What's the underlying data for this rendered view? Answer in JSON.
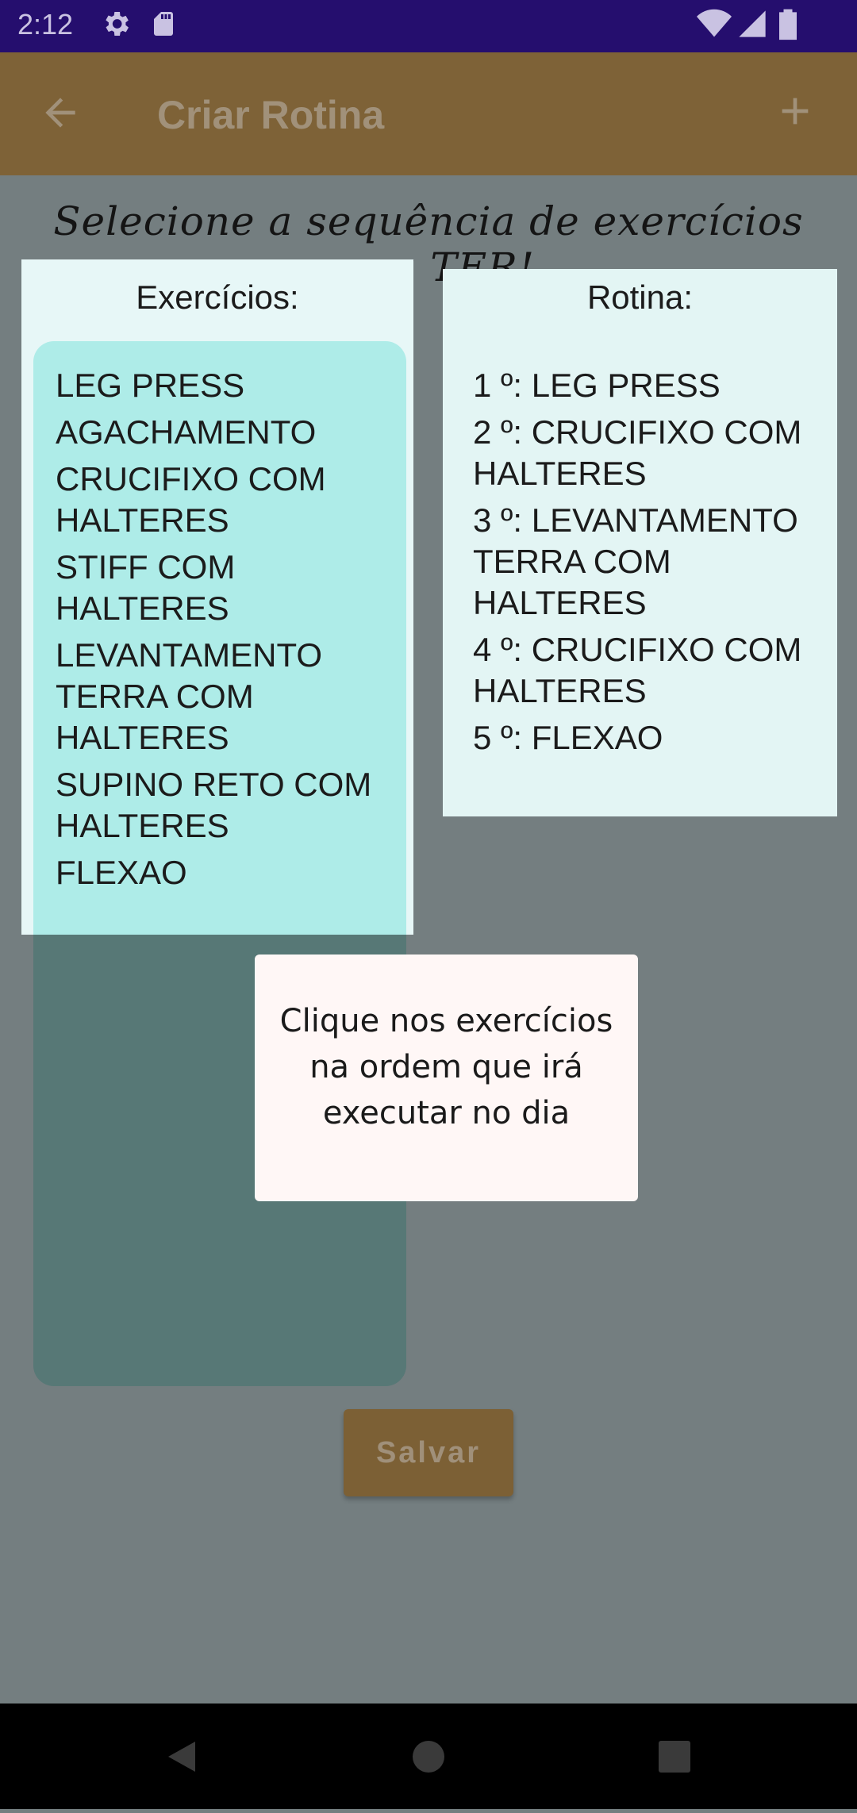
{
  "status_bar": {
    "time": "2:12",
    "icons": [
      "gear-icon",
      "sd-card-icon",
      "wifi-icon",
      "cell-signal-icon",
      "battery-icon"
    ]
  },
  "app_bar": {
    "title": "Criar Rotina",
    "back_icon": "arrow-left-icon",
    "add_icon": "plus-icon"
  },
  "main": {
    "subtitle": "Selecione a sequência de exercícios para TER!",
    "exercises_title": "Exercícios:",
    "exercises": [
      "LEG PRESS",
      "AGACHAMENTO",
      "CRUCIFIXO COM HALTERES",
      "STIFF COM HALTERES",
      "LEVANTAMENTO TERRA COM HALTERES",
      "SUPINO RETO COM HALTERES",
      "FLEXAO"
    ],
    "routine_title": "Rotina:",
    "routine": [
      "1 º: LEG PRESS",
      "2 º: CRUCIFIXO COM HALTERES",
      "3 º: LEVANTAMENTO TERRA COM HALTERES",
      "4 º: CRUCIFIXO COM HALTERES",
      "5 º: FLEXAO"
    ],
    "save_label": "Salvar"
  },
  "toast": {
    "message": "Clique nos exercícios na ordem que irá executar no dia"
  },
  "nav_bar": {
    "icons": [
      "back-triangle-icon",
      "home-circle-icon",
      "recents-square-icon"
    ]
  },
  "colors": {
    "status_bar": "#250e6e",
    "app_bar": "#7e6237",
    "scrim_background": "#747e80",
    "exercise_list": "#aeece8",
    "routine_panel": "#e3f5f4",
    "toast": "#fff7f6"
  }
}
